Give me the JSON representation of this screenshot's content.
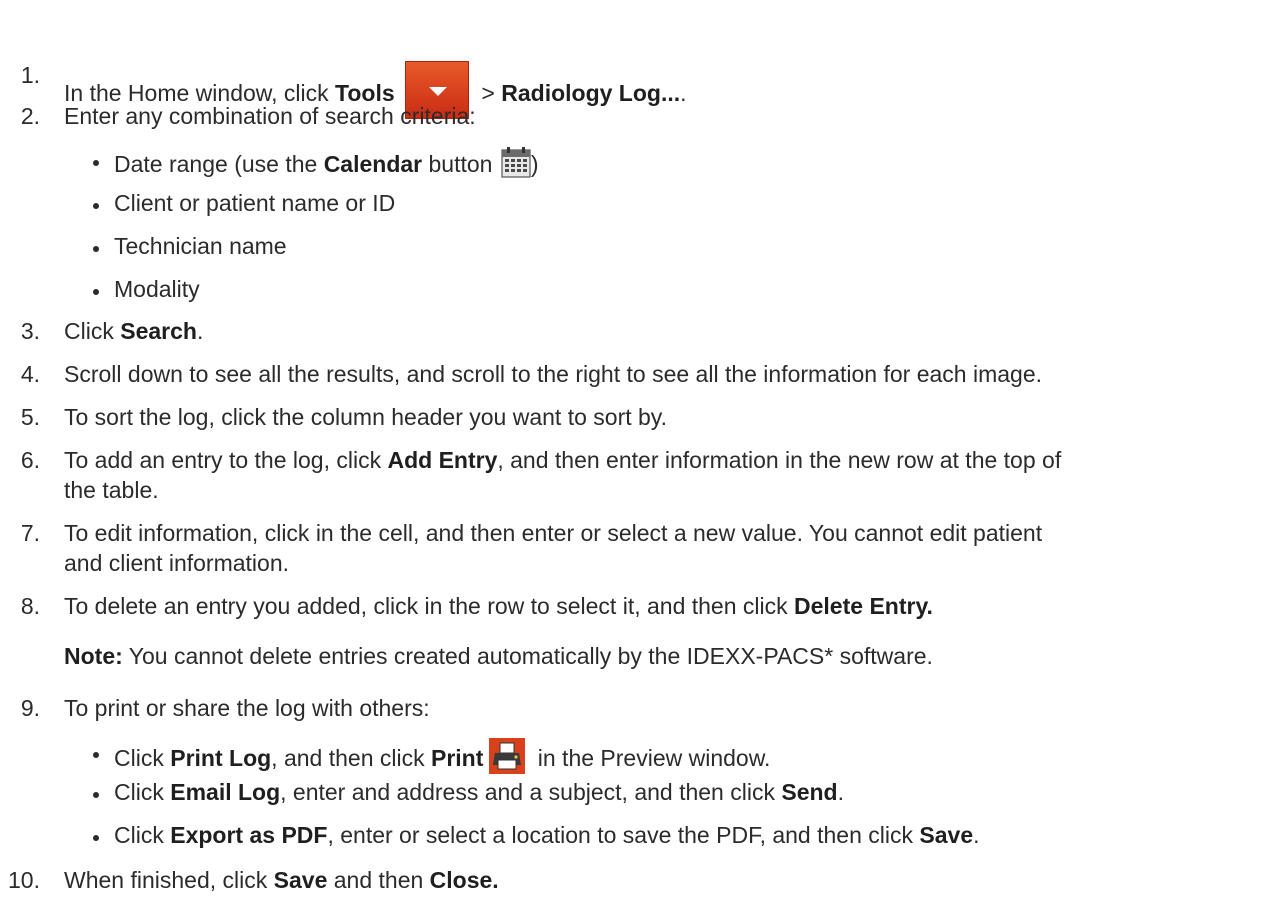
{
  "steps": {
    "s1": {
      "num": "1.",
      "pre": "In the Home window, click ",
      "tools": "Tools",
      "sep": " > ",
      "radiology": "Radiology Log...",
      "post": "."
    },
    "s2": {
      "num": "2.",
      "text": "Enter any combination of search criteria:"
    },
    "s2_bullets": {
      "b1_pre": "Date range (use the ",
      "b1_calendar": "Calendar",
      "b1_mid": " button ",
      "b1_post": ")",
      "b2": "Client or patient name or ID",
      "b3": "Technician name",
      "b4": "Modality"
    },
    "s3": {
      "num": "3.",
      "pre": "Click ",
      "search": "Search",
      "post": "."
    },
    "s4": {
      "num": "4.",
      "text": "Scroll down to see all the results, and scroll to the right to see all the information for each image."
    },
    "s5": {
      "num": "5.",
      "text": "To sort the log, click the column header you want to sort by."
    },
    "s6": {
      "num": "6.",
      "pre": "To add an entry to the log, click ",
      "add": "Add Entry",
      "post": ", and then enter information in the new row at the top of",
      "cont": "the table."
    },
    "s7": {
      "num": "7.",
      "text": "To edit information, click in the cell, and then enter or select a new value. You cannot edit patient",
      "cont": "and client information."
    },
    "s8": {
      "num": "8.",
      "pre": "To delete an entry you added, click in the row to select it, and then click ",
      "delete": "Delete Entry."
    },
    "note": {
      "label": "Note:",
      "text": " You cannot delete entries created automatically by the IDEXX-PACS* software."
    },
    "s9": {
      "num": "9.",
      "text": "To print or share the log with others:"
    },
    "s9_bullets": {
      "b1_pre": "Click ",
      "b1_printlog": "Print Log",
      "b1_mid": ", and then click ",
      "b1_print": "Print",
      "b1_post": " in the Preview window.",
      "b2_pre": "Click ",
      "b2_email": "Email Log",
      "b2_mid": ", enter and address and a subject, and then click ",
      "b2_send": "Send",
      "b2_post": ".",
      "b3_pre": "Click ",
      "b3_export": "Export as PDF",
      "b3_mid": ", enter or select a location to save the PDF, and then click ",
      "b3_save": "Save",
      "b3_post": "."
    },
    "s10": {
      "num": "10.",
      "pre": "When finished, click ",
      "save": "Save",
      "mid": " and then ",
      "close": "Close."
    }
  },
  "icons": {
    "tools": "tools-dropdown-icon",
    "calendar": "calendar-icon",
    "print": "print-icon"
  },
  "colors": {
    "tools_icon": "#d9401c",
    "print_icon": "#d9401c"
  }
}
